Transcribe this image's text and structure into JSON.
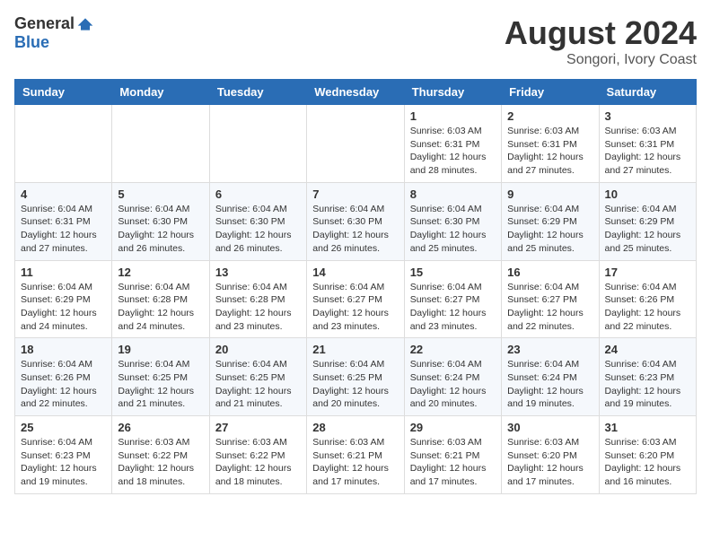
{
  "header": {
    "logo_general": "General",
    "logo_blue": "Blue",
    "month_year": "August 2024",
    "location": "Songori, Ivory Coast"
  },
  "weekdays": [
    "Sunday",
    "Monday",
    "Tuesday",
    "Wednesday",
    "Thursday",
    "Friday",
    "Saturday"
  ],
  "weeks": [
    [
      {
        "day": "",
        "info": ""
      },
      {
        "day": "",
        "info": ""
      },
      {
        "day": "",
        "info": ""
      },
      {
        "day": "",
        "info": ""
      },
      {
        "day": "1",
        "info": "Sunrise: 6:03 AM\nSunset: 6:31 PM\nDaylight: 12 hours\nand 28 minutes."
      },
      {
        "day": "2",
        "info": "Sunrise: 6:03 AM\nSunset: 6:31 PM\nDaylight: 12 hours\nand 27 minutes."
      },
      {
        "day": "3",
        "info": "Sunrise: 6:03 AM\nSunset: 6:31 PM\nDaylight: 12 hours\nand 27 minutes."
      }
    ],
    [
      {
        "day": "4",
        "info": "Sunrise: 6:04 AM\nSunset: 6:31 PM\nDaylight: 12 hours\nand 27 minutes."
      },
      {
        "day": "5",
        "info": "Sunrise: 6:04 AM\nSunset: 6:30 PM\nDaylight: 12 hours\nand 26 minutes."
      },
      {
        "day": "6",
        "info": "Sunrise: 6:04 AM\nSunset: 6:30 PM\nDaylight: 12 hours\nand 26 minutes."
      },
      {
        "day": "7",
        "info": "Sunrise: 6:04 AM\nSunset: 6:30 PM\nDaylight: 12 hours\nand 26 minutes."
      },
      {
        "day": "8",
        "info": "Sunrise: 6:04 AM\nSunset: 6:30 PM\nDaylight: 12 hours\nand 25 minutes."
      },
      {
        "day": "9",
        "info": "Sunrise: 6:04 AM\nSunset: 6:29 PM\nDaylight: 12 hours\nand 25 minutes."
      },
      {
        "day": "10",
        "info": "Sunrise: 6:04 AM\nSunset: 6:29 PM\nDaylight: 12 hours\nand 25 minutes."
      }
    ],
    [
      {
        "day": "11",
        "info": "Sunrise: 6:04 AM\nSunset: 6:29 PM\nDaylight: 12 hours\nand 24 minutes."
      },
      {
        "day": "12",
        "info": "Sunrise: 6:04 AM\nSunset: 6:28 PM\nDaylight: 12 hours\nand 24 minutes."
      },
      {
        "day": "13",
        "info": "Sunrise: 6:04 AM\nSunset: 6:28 PM\nDaylight: 12 hours\nand 23 minutes."
      },
      {
        "day": "14",
        "info": "Sunrise: 6:04 AM\nSunset: 6:27 PM\nDaylight: 12 hours\nand 23 minutes."
      },
      {
        "day": "15",
        "info": "Sunrise: 6:04 AM\nSunset: 6:27 PM\nDaylight: 12 hours\nand 23 minutes."
      },
      {
        "day": "16",
        "info": "Sunrise: 6:04 AM\nSunset: 6:27 PM\nDaylight: 12 hours\nand 22 minutes."
      },
      {
        "day": "17",
        "info": "Sunrise: 6:04 AM\nSunset: 6:26 PM\nDaylight: 12 hours\nand 22 minutes."
      }
    ],
    [
      {
        "day": "18",
        "info": "Sunrise: 6:04 AM\nSunset: 6:26 PM\nDaylight: 12 hours\nand 22 minutes."
      },
      {
        "day": "19",
        "info": "Sunrise: 6:04 AM\nSunset: 6:25 PM\nDaylight: 12 hours\nand 21 minutes."
      },
      {
        "day": "20",
        "info": "Sunrise: 6:04 AM\nSunset: 6:25 PM\nDaylight: 12 hours\nand 21 minutes."
      },
      {
        "day": "21",
        "info": "Sunrise: 6:04 AM\nSunset: 6:25 PM\nDaylight: 12 hours\nand 20 minutes."
      },
      {
        "day": "22",
        "info": "Sunrise: 6:04 AM\nSunset: 6:24 PM\nDaylight: 12 hours\nand 20 minutes."
      },
      {
        "day": "23",
        "info": "Sunrise: 6:04 AM\nSunset: 6:24 PM\nDaylight: 12 hours\nand 19 minutes."
      },
      {
        "day": "24",
        "info": "Sunrise: 6:04 AM\nSunset: 6:23 PM\nDaylight: 12 hours\nand 19 minutes."
      }
    ],
    [
      {
        "day": "25",
        "info": "Sunrise: 6:04 AM\nSunset: 6:23 PM\nDaylight: 12 hours\nand 19 minutes."
      },
      {
        "day": "26",
        "info": "Sunrise: 6:03 AM\nSunset: 6:22 PM\nDaylight: 12 hours\nand 18 minutes."
      },
      {
        "day": "27",
        "info": "Sunrise: 6:03 AM\nSunset: 6:22 PM\nDaylight: 12 hours\nand 18 minutes."
      },
      {
        "day": "28",
        "info": "Sunrise: 6:03 AM\nSunset: 6:21 PM\nDaylight: 12 hours\nand 17 minutes."
      },
      {
        "day": "29",
        "info": "Sunrise: 6:03 AM\nSunset: 6:21 PM\nDaylight: 12 hours\nand 17 minutes."
      },
      {
        "day": "30",
        "info": "Sunrise: 6:03 AM\nSunset: 6:20 PM\nDaylight: 12 hours\nand 17 minutes."
      },
      {
        "day": "31",
        "info": "Sunrise: 6:03 AM\nSunset: 6:20 PM\nDaylight: 12 hours\nand 16 minutes."
      }
    ]
  ]
}
